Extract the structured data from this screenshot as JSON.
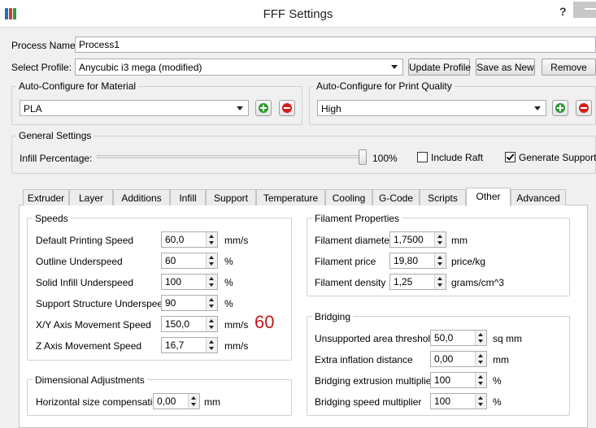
{
  "window": {
    "title": "FFF Settings",
    "help": "?"
  },
  "process": {
    "label": "Process Name:",
    "value": "Process1"
  },
  "profile": {
    "label": "Select Profile:",
    "value": "Anycubic i3 mega (modified)",
    "update_label": "Update Profile",
    "saveas_label": "Save as New",
    "remove_label": "Remove"
  },
  "material": {
    "title": "Auto-Configure for Material",
    "value": "PLA"
  },
  "quality": {
    "title": "Auto-Configure for Print Quality",
    "value": "High"
  },
  "general": {
    "title": "General Settings",
    "infill_label": "Infill Percentage:",
    "infill_value": "100%",
    "infill_level": 1.0,
    "raft_label": "Include Raft",
    "raft_checked": false,
    "support_label": "Generate Support",
    "support_checked": true
  },
  "tabs": [
    "Extruder",
    "Layer",
    "Additions",
    "Infill",
    "Support",
    "Temperature",
    "Cooling",
    "G-Code",
    "Scripts",
    "Other",
    "Advanced"
  ],
  "active_tab": "Other",
  "speeds": {
    "title": "Speeds",
    "rows": [
      {
        "label": "Default Printing Speed",
        "value": "60,0",
        "unit": "mm/s"
      },
      {
        "label": "Outline Underspeed",
        "value": "60",
        "unit": "%"
      },
      {
        "label": "Solid Infill Underspeed",
        "value": "100",
        "unit": "%"
      },
      {
        "label": "Support Structure Underspeed",
        "value": "90",
        "unit": "%"
      },
      {
        "label": "X/Y Axis Movement Speed",
        "value": "150,0",
        "unit": "mm/s"
      },
      {
        "label": "Z Axis Movement Speed",
        "value": "16,7",
        "unit": "mm/s"
      }
    ]
  },
  "overlay_number": "60",
  "dimensional": {
    "title": "Dimensional Adjustments",
    "label": "Horizontal size compensation",
    "value": "0,00",
    "unit": "mm"
  },
  "filament": {
    "title": "Filament Properties",
    "rows": [
      {
        "label": "Filament diameter",
        "value": "1,7500",
        "unit": "mm"
      },
      {
        "label": "Filament price",
        "value": "19,80",
        "unit": "price/kg"
      },
      {
        "label": "Filament density",
        "value": "1,25",
        "unit": "grams/cm^3"
      }
    ]
  },
  "bridging": {
    "title": "Bridging",
    "rows": [
      {
        "label": "Unsupported area threshold",
        "value": "50,0",
        "unit": "sq mm"
      },
      {
        "label": "Extra inflation distance",
        "value": "0,00",
        "unit": "mm"
      },
      {
        "label": "Bridging extrusion multiplier",
        "value": "100",
        "unit": "%"
      },
      {
        "label": "Bridging speed multiplier",
        "value": "100",
        "unit": "%"
      }
    ]
  },
  "colors": {
    "add": "#2e9b2e",
    "remove": "#d01f1f",
    "overlay": "#c0181b"
  }
}
